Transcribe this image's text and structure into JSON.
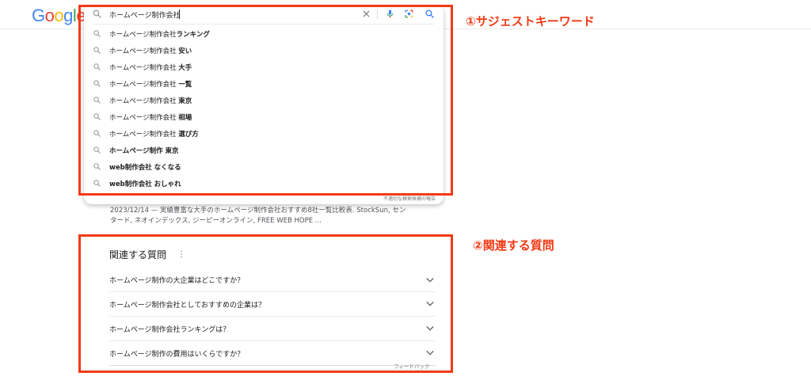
{
  "header": {
    "logo_text": "Google",
    "logo_colors": [
      "#4285F4",
      "#EA4335",
      "#FBBC05",
      "#4285F4",
      "#34A853",
      "#EA4335"
    ]
  },
  "search": {
    "query": "ホームページ制作会社",
    "icons": {
      "search": "search-icon",
      "clear": "close-icon",
      "mic": "mic-icon",
      "lens": "camera-icon",
      "submit": "search-icon"
    }
  },
  "suggestions": [
    {
      "prefix": "ホームページ制作会社",
      "bold": "ランキング"
    },
    {
      "prefix": "ホームページ制作会社 ",
      "bold": "安い"
    },
    {
      "prefix": "ホームページ制作会社 ",
      "bold": "大手"
    },
    {
      "prefix": "ホームページ制作会社 ",
      "bold": "一覧"
    },
    {
      "prefix": "ホームページ制作会社 ",
      "bold": "東京"
    },
    {
      "prefix": "ホームページ制作会社 ",
      "bold": "相場"
    },
    {
      "prefix": "ホームページ制作会社 ",
      "bold": "選び方"
    },
    {
      "prefix": "",
      "bold": "ホームページ制作 東京"
    },
    {
      "prefix": "",
      "bold": "web制作会社 なくなる"
    },
    {
      "prefix": "",
      "bold": "web制作会社 おしゃれ"
    }
  ],
  "report_link": "不適切な検索候補の報告",
  "snippet": {
    "line1": "2023/12/14 — 実績豊富な大手のホームページ制作会社おすすめ8社一覧比較表. StockSun, セン",
    "line2": "タード, ネオインデックス, ジーピーオンライン, FREE WEB HOPE ..."
  },
  "annotations": {
    "label1": "①サジェストキーワード",
    "label2": "②関連する質問",
    "color": "#f23a14"
  },
  "related_questions": {
    "title": "関連する質問",
    "more_icon": "⋮",
    "items": [
      "ホームページ制作の大企業はどこですか？",
      "ホームページ制作会社としておすすめの企業は？",
      "ホームページ制作会社ランキングは？",
      "ホームページ制作の費用はいくらですか？"
    ],
    "feedback": "フィードバック"
  }
}
